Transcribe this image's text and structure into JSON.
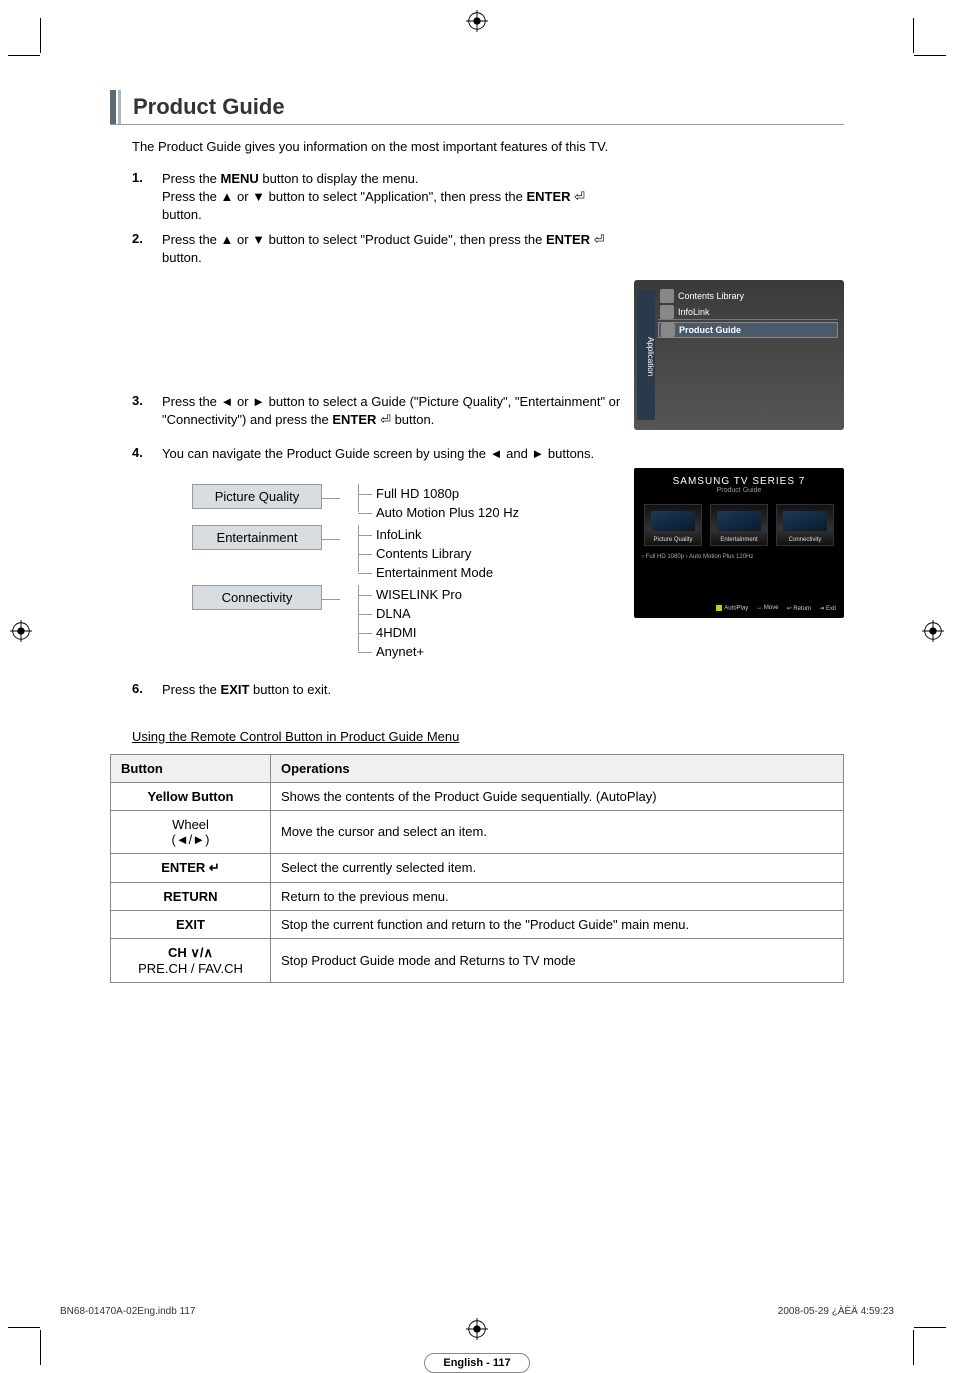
{
  "title": "Product Guide",
  "intro": "The Product Guide gives you information on the most important features of this TV.",
  "steps": {
    "s1": {
      "num": "1.",
      "line1a": "Press the ",
      "line1b": "MENU",
      "line1c": " button to display the menu.",
      "line2a": "Press the ▲ or ▼ button to select \"Application\", then press the ",
      "line2b": "ENTER",
      "line2c": " ",
      "line2d": "↵",
      "line2e": " button."
    },
    "s2": {
      "num": "2.",
      "a": "Press the ▲ or ▼ button to select \"Product Guide\", then press the ",
      "b": "ENTER",
      "c": " ↵ button."
    },
    "s3": {
      "num": "3.",
      "a": "Press the ◄ or ► button to select a Guide (\"Picture Quality\", \"Entertainment\" or \"Connectivity\") and press the ",
      "b": "ENTER",
      "c": " ↵ button."
    },
    "s4": {
      "num": "4.",
      "a": "You can navigate the Product Guide screen by using the ◄ and ► buttons."
    },
    "s6": {
      "num": "6.",
      "a": "Press the ",
      "b": "EXIT",
      "c": " button to exit."
    }
  },
  "osd1": {
    "tab": "Application",
    "r1": "Contents Library",
    "r2": "InfoLink",
    "r3": "Product Guide"
  },
  "osd2": {
    "brand": "SAMSUNG TV SERIES 7",
    "sub": "Product Guide",
    "t1": "Picture Quality",
    "t2": "Entertainment",
    "t3": "Connectivity",
    "chips": "› Full HD 1080p   › Auto Motion Plus 120Hz",
    "f1": "AutoPlay",
    "f2": "Move",
    "f3": "Return",
    "f4": "Exit"
  },
  "tree": {
    "cat1": "Picture Quality",
    "c1i1": "Full HD 1080p",
    "c1i2": "Auto Motion Plus 120 Hz",
    "cat2": "Entertainment",
    "c2i1": "InfoLink",
    "c2i2": "Contents Library",
    "c2i3": "Entertainment Mode",
    "cat3": "Connectivity",
    "c3i1": "WISELINK Pro",
    "c3i2": "DLNA",
    "c3i3": "4HDMI",
    "c3i4": "Anynet+"
  },
  "subhead": "Using the Remote Control Button in Product Guide Menu",
  "table": {
    "h1": "Button",
    "h2": "Operations",
    "r1b": "Yellow Button",
    "r1o": "Shows the contents of the Product Guide sequentially. (AutoPlay)",
    "r2b1": "Wheel",
    "r2b2": "(◄/►)",
    "r2o": "Move the cursor and select an item.",
    "r3b": "ENTER ↵",
    "r3o": "Select the currently selected item.",
    "r4b": "RETURN",
    "r4o": "Return to the previous menu.",
    "r5b": "EXIT",
    "r5o": "Stop the current function and return to the \"Product Guide\" main menu.",
    "r6b1": "CH ∨/∧",
    "r6b2": "PRE.CH / FAV.CH",
    "r6o": "Stop Product Guide mode and Returns to TV mode"
  },
  "pagefoot": "English - 117",
  "printL": "BN68-01470A-02Eng.indb   117",
  "printR": "2008-05-29   ¿ÀÈÄ 4:59:23"
}
